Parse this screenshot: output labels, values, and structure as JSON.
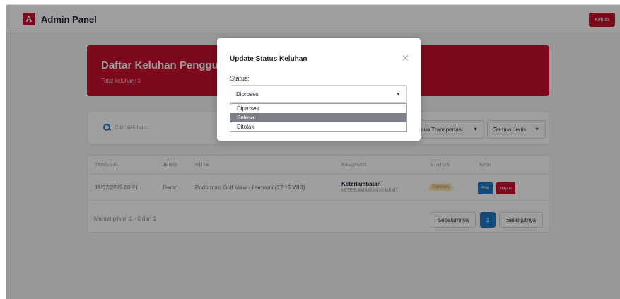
{
  "header": {
    "logo_letter": "A",
    "title": "Admin Panel",
    "logout_label": "Keluar"
  },
  "hero": {
    "title": "Daftar Keluhan Pengguna",
    "subtitle": "Total keluhan: 1"
  },
  "filters": {
    "search_placeholder": "Cari keluhan...",
    "transport_value": "Semua Transportasi",
    "type_value": "Semua Jenis"
  },
  "table": {
    "columns": [
      "TANGGAL",
      "JENIS",
      "RUTE",
      "KELUHAN",
      "STATUS",
      "AKSI"
    ],
    "rows": [
      {
        "date": "11/07/2025 00:21",
        "type": "Damri",
        "route": "Podomoro Golf View - Harmoni (17:15 WIB)",
        "complaint_title": "Keterlambatan",
        "complaint_detail": "KETERLAMBATAN 10 MENIT",
        "status": "Diproses",
        "edit_label": "Edit",
        "delete_label": "Hapus"
      }
    ],
    "footer_info": "Menampilkan 1 - 0 dari 1",
    "prev_label": "Sebelumnya",
    "page_number": "1",
    "next_label": "Selanjutnya"
  },
  "modal": {
    "title": "Update Status Keluhan",
    "close_symbol": "×",
    "status_label": "Status:",
    "selected_value": "Diproses",
    "options": [
      "Diproses",
      "Selesai",
      "Ditolak"
    ],
    "highlighted_option": "Selesai"
  },
  "colors": {
    "brand_red": "#c8102e",
    "primary_blue": "#1f78c8",
    "badge_yellow": "#fbe7b4"
  }
}
